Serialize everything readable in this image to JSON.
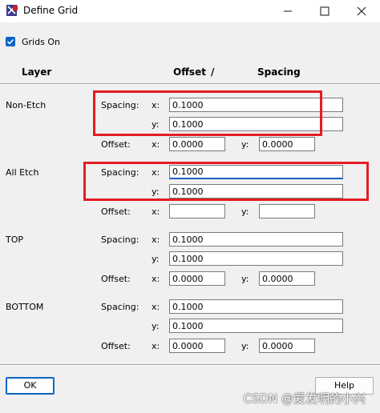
{
  "window": {
    "title": "Define Grid",
    "controls": [
      "minimize-icon",
      "maximize-icon",
      "close-icon"
    ]
  },
  "grids_on": {
    "label": "Grids On",
    "checked": true
  },
  "headers": {
    "layer": "Layer",
    "offset": "Offset",
    "slash": "/",
    "spacing": "Spacing"
  },
  "labels": {
    "spacing": "Spacing:",
    "offset": "Offset:",
    "x": "x:",
    "y": "y:"
  },
  "layers": [
    {
      "name": "Non-Etch",
      "spacing_x": "0.1000",
      "spacing_y": "0.1000",
      "offset_x": "0.0000",
      "offset_y": "0.0000"
    },
    {
      "name": "All Etch",
      "spacing_x": "0.1000",
      "spacing_y": "0.1000",
      "offset_x": "",
      "offset_y": ""
    },
    {
      "name": "TOP",
      "spacing_x": "0.1000",
      "spacing_y": "0.1000",
      "offset_x": "0.0000",
      "offset_y": "0.0000"
    },
    {
      "name": "BOTTOM",
      "spacing_x": "0.1000",
      "spacing_y": "0.1000",
      "offset_x": "0.0000",
      "offset_y": "0.0000"
    }
  ],
  "buttons": {
    "ok": "OK",
    "help": "Help"
  },
  "watermark": "CSDN @爱发明的小兴",
  "colors": {
    "highlight": "#e51c23",
    "accent": "#0a64c8"
  }
}
